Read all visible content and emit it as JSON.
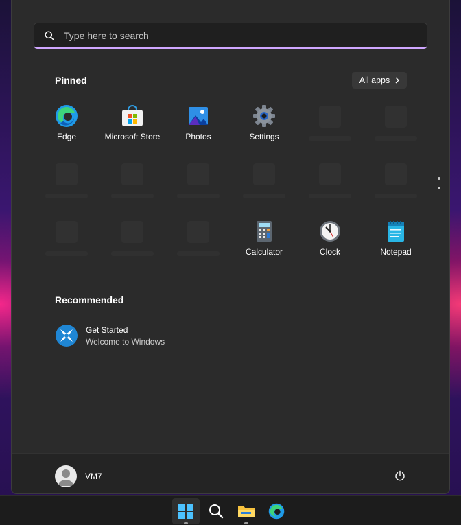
{
  "search": {
    "placeholder": "Type here to search"
  },
  "pinned": {
    "title": "Pinned",
    "all_apps_label": "All apps",
    "apps": [
      {
        "label": "Edge",
        "icon": "edge-icon"
      },
      {
        "label": "Microsoft Store",
        "icon": "microsoft-store-icon"
      },
      {
        "label": "Photos",
        "icon": "photos-icon"
      },
      {
        "label": "Settings",
        "icon": "settings-gear-icon"
      },
      {
        "label": "Calculator",
        "icon": "calculator-icon"
      },
      {
        "label": "Clock",
        "icon": "clock-icon"
      },
      {
        "label": "Notepad",
        "icon": "notepad-icon"
      }
    ]
  },
  "recommended": {
    "title": "Recommended",
    "items": [
      {
        "title": "Get Started",
        "subtitle": "Welcome to Windows",
        "icon": "get-started-icon"
      }
    ]
  },
  "footer": {
    "username": "VM7"
  },
  "taskbar": {
    "items": [
      "start-icon",
      "search-icon",
      "file-explorer-icon",
      "edge-icon"
    ]
  },
  "colors": {
    "accent": "#cfa6ff",
    "menu_bg": "#2b2b2b",
    "footer_bg": "#242424"
  }
}
